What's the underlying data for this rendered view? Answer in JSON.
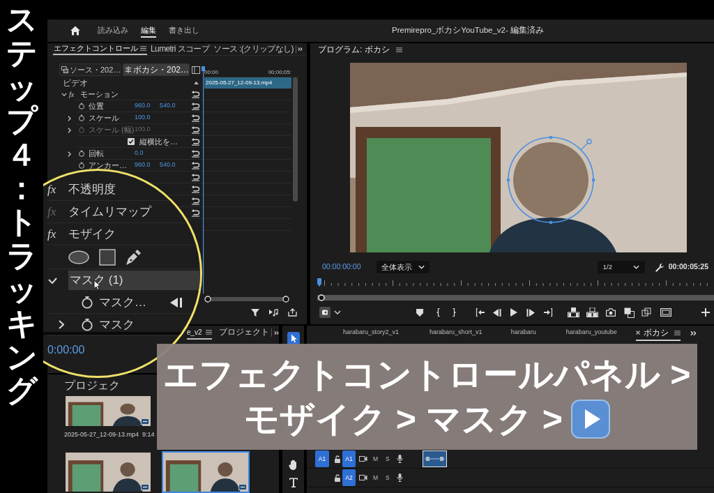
{
  "caption": {
    "text": "ステップ４：トラッキング"
  },
  "workspace": {
    "tabs": [
      {
        "label": "読み込み",
        "selected": false
      },
      {
        "label": "編集",
        "selected": true
      },
      {
        "label": "書き出し",
        "selected": false
      }
    ]
  },
  "window": {
    "title": "Premirepro_ボカシYouTube_v2- 編集済み"
  },
  "effect_controls": {
    "tabs": [
      {
        "label": "エフェクトコントロール",
        "selected": true,
        "menu": true
      },
      {
        "label": "Lumetri スコープ",
        "selected": false
      },
      {
        "label": "ソース :(クリップなし)",
        "selected": false
      }
    ],
    "clip_selectors": [
      {
        "label": "ソース・202…",
        "selected": false
      },
      {
        "label": "ボカシ・202…",
        "selected": true
      }
    ],
    "ruler": [
      "00:00",
      "00;00;05:"
    ],
    "clip": "2025-05-27_12-09-13.mp4",
    "section": "ビデオ",
    "rows": [
      {
        "kind": "effect",
        "badge": "fx",
        "label": "モーション",
        "expanded": true
      },
      {
        "kind": "param",
        "label": "位置",
        "values": [
          "960.0",
          "540.0"
        ],
        "disabled": false
      },
      {
        "kind": "param",
        "label": "スケール",
        "values": [
          "100.0"
        ],
        "expanded": false,
        "disabled": false
      },
      {
        "kind": "param",
        "label": "スケール (幅)",
        "values": [
          "100.0"
        ],
        "expanded": false,
        "disabled": true
      },
      {
        "kind": "checkbox",
        "label": "縦横比を…",
        "checked": true
      },
      {
        "kind": "param",
        "label": "回転",
        "values": [
          "0.0"
        ],
        "expanded": false,
        "disabled": false
      },
      {
        "kind": "param",
        "label": "アンカー…",
        "values": [
          "960.0",
          "540.0"
        ],
        "disabled": false
      }
    ]
  },
  "magnifier": {
    "rows": [
      {
        "kind": "effect",
        "badge": "fx",
        "label": "不透明度",
        "enabled": true
      },
      {
        "kind": "effect",
        "badge": "fx",
        "label": "タイムリマップ",
        "enabled": false
      },
      {
        "kind": "effect",
        "badge": "fx",
        "label": "モザイク",
        "enabled": true
      },
      {
        "kind": "mask_tools"
      },
      {
        "kind": "mask",
        "label": "マスク (1)",
        "expanded": true,
        "selected": true
      },
      {
        "kind": "tracked",
        "label": "マスク…"
      },
      {
        "kind": "param",
        "label": "マスク",
        "expanded": false
      }
    ]
  },
  "program": {
    "title": "プログラム: ボカシ",
    "timecode": "00:00:00:00",
    "fit": "全体表示",
    "resolution": "1/2",
    "duration": "00:00:05:25"
  },
  "source_panel": {
    "tabs": [
      {
        "label": "e_v2",
        "selected": true,
        "menu": true
      },
      {
        "label": "プロジェクト",
        "selected": false
      }
    ],
    "timecode": "0:00:00"
  },
  "project": {
    "title": "プロジェク",
    "items": [
      {
        "name": "2025-05-27_12-09-13.mp4",
        "duration": "9:14",
        "selected": false
      },
      {
        "selected": false
      },
      {
        "selected": true
      }
    ]
  },
  "tools": [
    {
      "kind": "select",
      "selected": true
    },
    {
      "kind": "hand",
      "selected": false
    },
    {
      "kind": "type",
      "selected": false
    }
  ],
  "timeline": {
    "tabs": [
      {
        "label": "harabaru_story2_v1",
        "selected": false
      },
      {
        "label": "harabaru_short_v1",
        "selected": false
      },
      {
        "label": "harabaru",
        "selected": false
      },
      {
        "label": "harabaru_youtube",
        "selected": false
      },
      {
        "label": "ボカシ",
        "selected": true,
        "closable": true,
        "menu": true
      }
    ],
    "tracks": [
      {
        "label": "A1",
        "source": "A1",
        "mute": "M",
        "solo": "S",
        "clip": true
      },
      {
        "label": "A2",
        "mute": "M",
        "solo": "S"
      }
    ]
  },
  "banner": {
    "lines": [
      "エフェクトコントロールパネル >",
      "モザイク > マスク >"
    ]
  }
}
